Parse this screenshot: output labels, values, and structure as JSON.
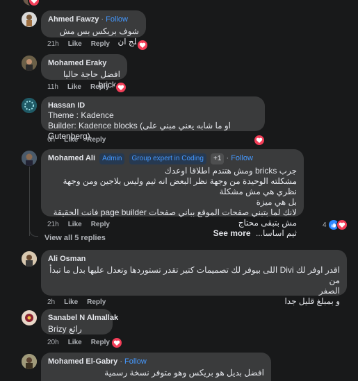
{
  "comments": [
    {
      "name": "Ahmed Fawzy",
      "follow": "Follow",
      "text": "شوف بريكس بس مش بلج ان",
      "time": "21h",
      "like": "Like",
      "reply": "Reply"
    },
    {
      "name": "Mohamed Eraky",
      "text": "افضل حاجة حاليا bricks",
      "time": "11h",
      "like": "Like",
      "reply": "Reply"
    },
    {
      "name": "Hassan ID",
      "line1": "Theme : Kadence",
      "line2": "Builder: Kadence blocks (او ما شابه يعني مبني على Gutenberg)",
      "time": "6h",
      "like": "Like",
      "reply": "Reply"
    },
    {
      "name": "Mohamed Ali",
      "badge_admin": "Admin",
      "badge_expert": "Group expert in Coding",
      "badge_plus": "+1",
      "follow": "Follow",
      "line1": "جرب bricks ومش هتندم اطلاقا اوعدك",
      "line2": "مشكلته الوحيدة من وجهة نظر البعض انه ثيم وليس بلاجين ومن وجهة نظري هي مش مشكلة",
      "line3": "بل هي ميزة",
      "line4": "لانك لما بتبني صفحات الموقع بباني صفحات page builder فانت الحقيقة مش بتبقى محتاج",
      "line5": "ثيم اساسا...",
      "see_more": "See more",
      "time": "21h",
      "like": "Like",
      "reply": "Reply",
      "reactions": "4"
    }
  ],
  "view_replies": "View all 5 replies",
  "replies": [
    {
      "name": "Ali Osman",
      "line1": "اقدر اوفر لك Divi اللى بيوفر لك تصميمات كتير تقدر تستوردها وتعدل عليها بدل ما تبدأ من",
      "line2": "الصفر",
      "line3": "و بمبلغ قليل جدا",
      "time": "2h",
      "like": "Like",
      "reply": "Reply"
    },
    {
      "name": "Sanabel N Almallak",
      "text": "Brizy رائع",
      "time": "20h",
      "like": "Like",
      "reply": "Reply"
    },
    {
      "name": "Mohamed El-Gabry",
      "follow": "Follow",
      "text": "افضل بديل هو بريكس وهو متوفر نسخة رسمية"
    }
  ],
  "colors": {
    "background": "#18191a",
    "bubble": "#3a3b3c",
    "link": "#4599ff",
    "love": "#f33e58",
    "like": "#2d88ff"
  }
}
